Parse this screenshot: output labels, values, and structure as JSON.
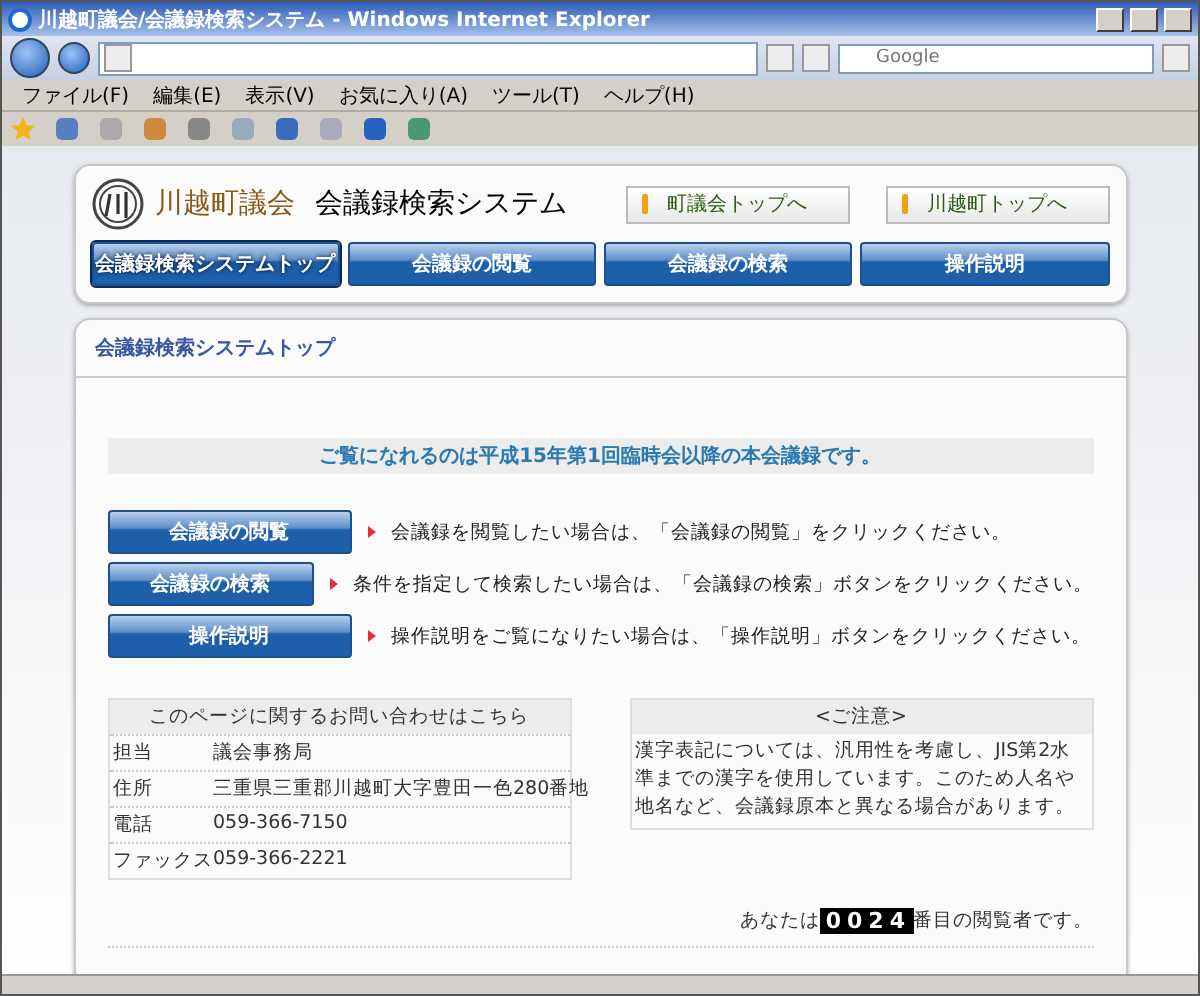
{
  "window": {
    "title": "川越町議会/会議録検索システム - Windows Internet Explorer"
  },
  "search": {
    "placeholder": "Google"
  },
  "menu": [
    "ファイル(F)",
    "編集(E)",
    "表示(V)",
    "お気に入り(A)",
    "ツール(T)",
    "ヘルプ(H)"
  ],
  "site": {
    "org": "川越町議会",
    "system": "会議録検索システム"
  },
  "top_links": [
    "町議会トップへ",
    "川越町トップへ"
  ],
  "nav": [
    {
      "label": "会議録検索システムトップ",
      "selected": true
    },
    {
      "label": "会議録の閲覧",
      "selected": false
    },
    {
      "label": "会議録の検索",
      "selected": false
    },
    {
      "label": "操作説明",
      "selected": false
    }
  ],
  "page_title": "会議録検索システムトップ",
  "notice": "ご覧になれるのは平成15年第1回臨時会以降の本会議録です。",
  "actions": [
    {
      "button": "会議録の閲覧",
      "text": "会議録を閲覧したい場合は、「会議録の閲覧」をクリックください。"
    },
    {
      "button": "会議録の検索",
      "text": "条件を指定して検索したい場合は、「会議録の検索」ボタンをクリックください。"
    },
    {
      "button": "操作説明",
      "text": "操作説明をご覧になりたい場合は、「操作説明」ボタンをクリックください。"
    }
  ],
  "contact": {
    "heading": "このページに関するお問い合わせはこちら",
    "rows": [
      {
        "label": "担当",
        "value": "議会事務局"
      },
      {
        "label": "住所",
        "value": "三重県三重郡川越町大字豊田一色280番地"
      },
      {
        "label": "電話",
        "value": "059-366-7150"
      },
      {
        "label": "ファックス",
        "value": "059-366-2221"
      }
    ]
  },
  "caution": {
    "heading": "<ご注意>",
    "text": "漢字表記については、汎用性を考慮し、JIS第2水準までの漢字を使用しています。このため人名や地名など、会議録原本と異なる場合があります。"
  },
  "visitor": {
    "before": "あなたは",
    "count": "0024",
    "after": "番目の閲覧者です。"
  }
}
